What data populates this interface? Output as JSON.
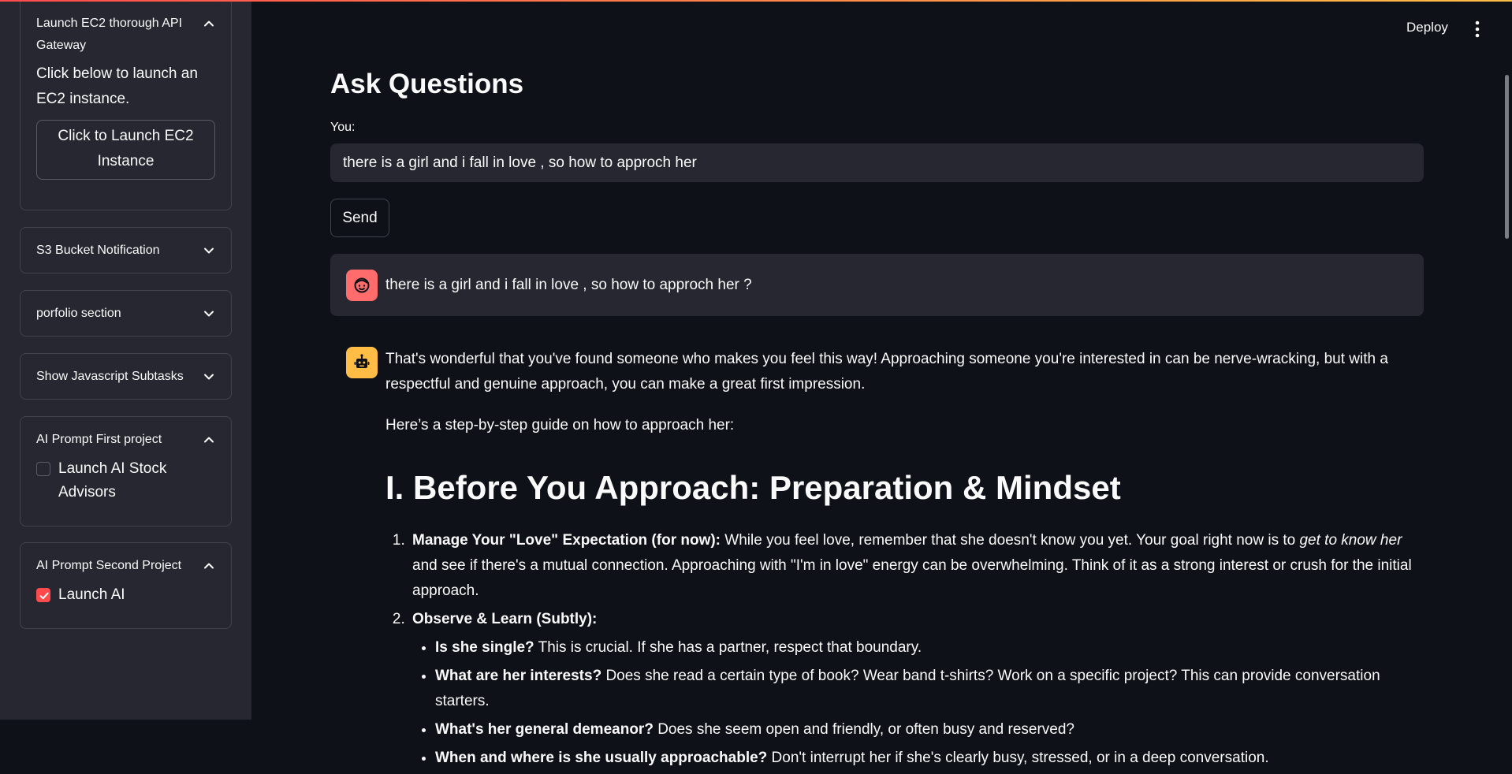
{
  "sidebar": {
    "expanders": [
      {
        "title": "Launch EC2 thorough API Gateway",
        "text": "Click below to launch an EC2 instance.",
        "button": "Click to Launch EC2 Instance"
      },
      {
        "title": "S3 Bucket Notification"
      },
      {
        "title": "porfolio section"
      },
      {
        "title": "Show Javascript Subtasks"
      },
      {
        "title": "AI Prompt First project",
        "checkbox_label": "Launch AI Stock Advisors",
        "checked": false
      },
      {
        "title": "AI Prompt Second Project",
        "checkbox_label": "Launch AI",
        "checked": true
      }
    ]
  },
  "header": {
    "deploy_label": "Deploy"
  },
  "main": {
    "title": "Ask Questions",
    "input_label": "You:",
    "input_value": "there is a girl and i fall in love , so how to approch her",
    "send_label": "Send",
    "user_message": "there is a girl and i fall in love , so how to approch her ?",
    "bot": {
      "intro": "That's wonderful that you've found someone who makes you feel this way! Approaching someone you're interested in can be nerve-wracking, but with a respectful and genuine approach, you can make a great first impression.",
      "guide": "Here’s a step-by-step guide on how to approach her:",
      "heading": "I. Before You Approach: Preparation & Mindset",
      "step1_bold": "Manage Your \"Love\" Expectation (for now):",
      "step1_text_a": " While you feel love, remember that she doesn't know you yet. Your goal right now is to ",
      "step1_italic": "get to know her",
      "step1_text_b": " and see if there's a mutual connection. Approaching with \"I'm in love\" energy can be overwhelming. Think of it as a strong interest or crush for the initial approach.",
      "step2_bold": "Observe & Learn (Subtly):",
      "sub": [
        {
          "bold": "Is she single?",
          "text": " This is crucial. If she has a partner, respect that boundary."
        },
        {
          "bold": "What are her interests?",
          "text": " Does she read a certain type of book? Wear band t-shirts? Work on a specific project? This can provide conversation starters."
        },
        {
          "bold": "What's her general demeanor?",
          "text": " Does she seem open and friendly, or often busy and reserved?"
        },
        {
          "bold": "When and where is she usually approachable?",
          "text": " Don't interrupt her if she's clearly busy, stressed, or in a deep conversation."
        }
      ]
    }
  },
  "colors": {
    "accent": "#ff4b4b",
    "bot_avatar": "#ffbd45",
    "user_avatar": "#ff6c6c",
    "background": "#0e1117",
    "sidebar": "#262730"
  }
}
